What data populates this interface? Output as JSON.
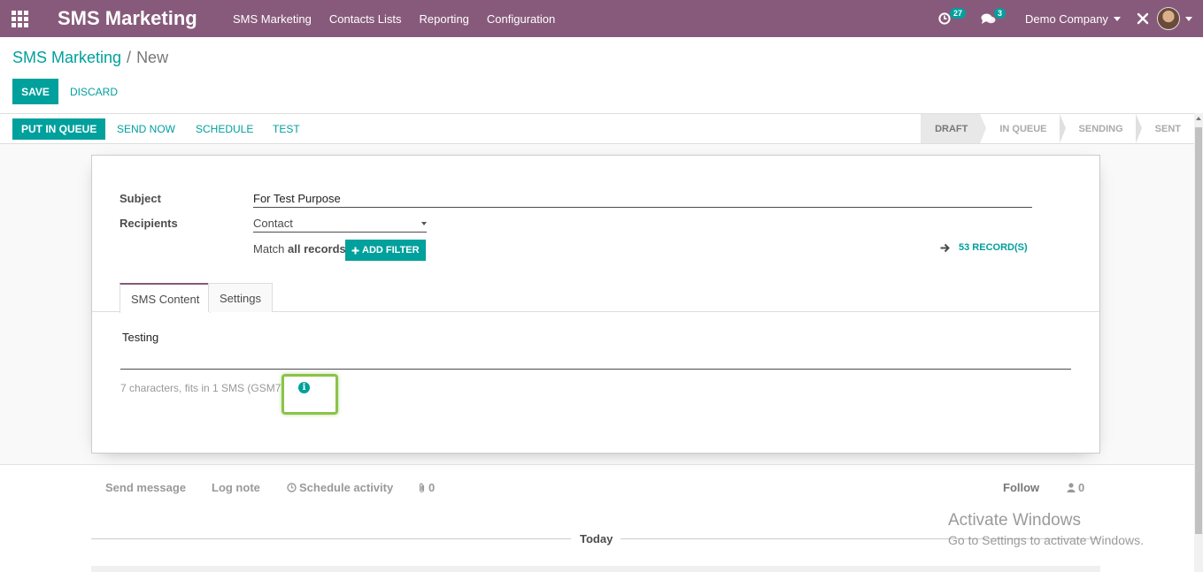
{
  "navbar": {
    "brand": "SMS Marketing",
    "menu": [
      "SMS Marketing",
      "Contacts Lists",
      "Reporting",
      "Configuration"
    ],
    "activity_count": "27",
    "message_count": "3",
    "company": "Demo Company"
  },
  "breadcrumb": {
    "parent": "SMS Marketing",
    "separator": "/",
    "current": "New"
  },
  "actions": {
    "save": "SAVE",
    "discard": "DISCARD"
  },
  "statusbar": {
    "buttons": [
      "PUT IN QUEUE",
      "SEND NOW",
      "SCHEDULE",
      "TEST"
    ],
    "stages": [
      "DRAFT",
      "IN QUEUE",
      "SENDING",
      "SENT"
    ],
    "active_stage": "DRAFT"
  },
  "form": {
    "subject_label": "Subject",
    "subject_value": "For Test Purpose",
    "recipients_label": "Recipients",
    "recipients_value": "Contact",
    "match_prefix": "Match",
    "match_bold": "all records",
    "add_filter": "ADD FILTER",
    "records": "53 RECORD(S)"
  },
  "tabs": [
    "SMS Content",
    "Settings"
  ],
  "sms": {
    "body": "Testing",
    "info": "7 characters, fits in 1 SMS (GSM7)"
  },
  "chatter": {
    "send_message": "Send message",
    "log_note": "Log note",
    "schedule_activity": "Schedule activity",
    "attachments": "0",
    "follow": "Follow",
    "followers": "0",
    "today": "Today"
  },
  "watermark": {
    "line1": "Activate Windows",
    "line2": "Go to Settings to activate Windows."
  },
  "colors": {
    "navbar": "#875a7b",
    "accent": "#00a09d",
    "highlight": "#8bc34a"
  }
}
